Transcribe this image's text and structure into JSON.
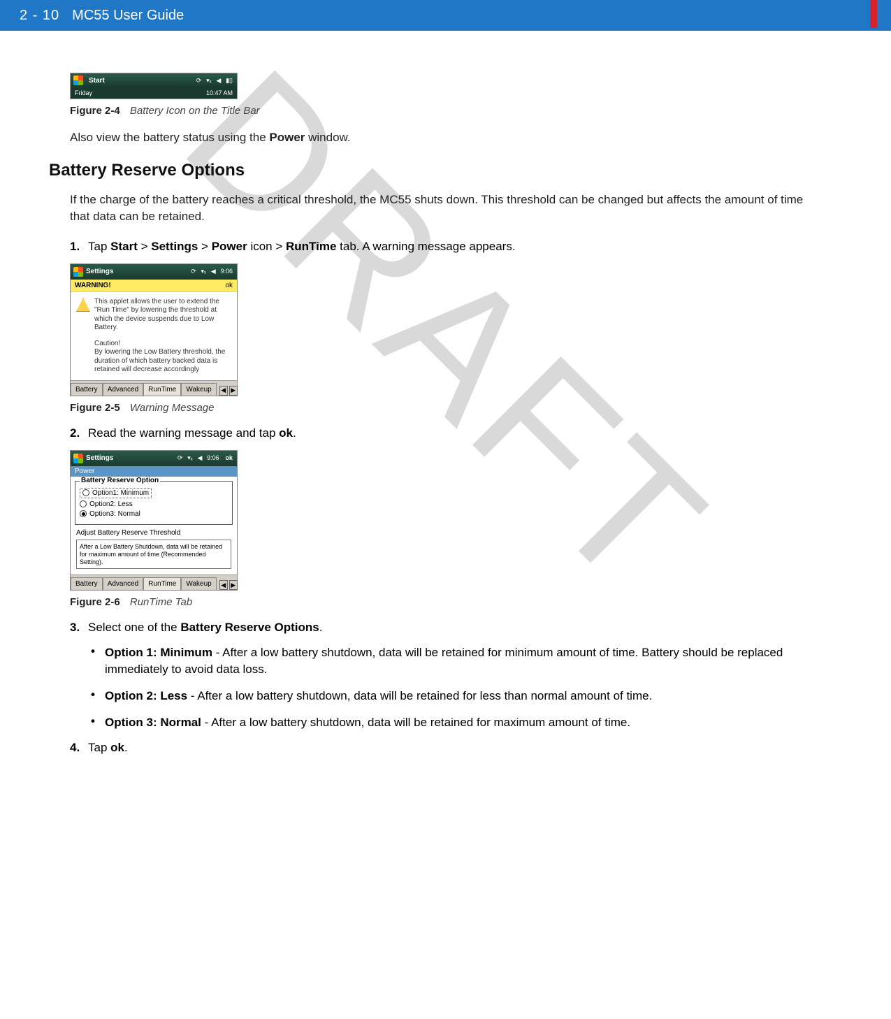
{
  "header": {
    "pageno": "2 - 10",
    "title": "MC55 User Guide"
  },
  "watermark": "DRAFT",
  "figure24": {
    "label": "Figure 2-4",
    "caption": "Battery Icon on the Title Bar",
    "titlebar": {
      "start": "Start",
      "day": "Friday",
      "time": "10:47 AM"
    }
  },
  "para_also_view_pre": "Also view the battery status using the ",
  "para_also_view_bold": "Power",
  "para_also_view_post": " window.",
  "section_heading": "Battery Reserve Options",
  "para_intro": "If the charge of the battery reaches a critical threshold, the MC55 shuts down. This threshold can be changed but affects the amount of time that data can be retained.",
  "step1": {
    "num": "1.",
    "pre": "Tap ",
    "b1": "Start",
    "s1": " > ",
    "b2": "Settings",
    "s2": " > ",
    "b3": "Power",
    "s3": " icon > ",
    "b4": "RunTime",
    "post": " tab. A warning message appears."
  },
  "figure25": {
    "label": "Figure 2-5",
    "caption": "Warning Message",
    "top_title": "Settings",
    "top_time": "9:06",
    "warn_title": "WARNING!",
    "ok": "ok",
    "body_p1": "This applet allows the user to extend the \"Run Time\" by lowering the threshold at which the device suspends due to Low Battery.",
    "body_p2_h": "Caution!",
    "body_p2": "By lowering the Low Battery threshold, the duration of which battery backed data is retained will decrease accordingly",
    "tabs": [
      "Battery",
      "Advanced",
      "RunTime",
      "Wakeup"
    ]
  },
  "step2": {
    "num": "2.",
    "pre": "Read the warning message and tap ",
    "b1": "ok",
    "post": "."
  },
  "figure26": {
    "label": "Figure 2-6",
    "caption": "RunTime Tab",
    "top_title": "Settings",
    "top_time": "9:06",
    "ok": "ok",
    "power_label": "Power",
    "fieldset_legend": "Battery Reserve Option",
    "opt1": "Option1: Minimum",
    "opt2": "Option2: Less",
    "opt3": "Option3: Normal",
    "adjust": "Adjust Battery Reserve Threshold",
    "desc": "After a Low Battery Shutdown, data will be retained for maximum amount of time (Recommended Setting).",
    "tabs": [
      "Battery",
      "Advanced",
      "RunTime",
      "Wakeup"
    ]
  },
  "step3": {
    "num": "3.",
    "pre": "Select one of the ",
    "b1": "Battery Reserve Options",
    "post": "."
  },
  "bullets": {
    "b1": {
      "bold": "Option 1: Minimum",
      "text": " - After a low battery shutdown, data will be retained for minimum amount of time. Battery should be replaced immediately to avoid data loss."
    },
    "b2": {
      "bold": "Option 2: Less",
      "text": " - After a low battery shutdown, data will be retained for less than normal amount of time."
    },
    "b3": {
      "bold": "Option 3: Normal",
      "text": " - After a low battery shutdown, data will be retained for maximum amount of time."
    }
  },
  "step4": {
    "num": "4.",
    "pre": "Tap ",
    "b1": "ok",
    "post": "."
  }
}
